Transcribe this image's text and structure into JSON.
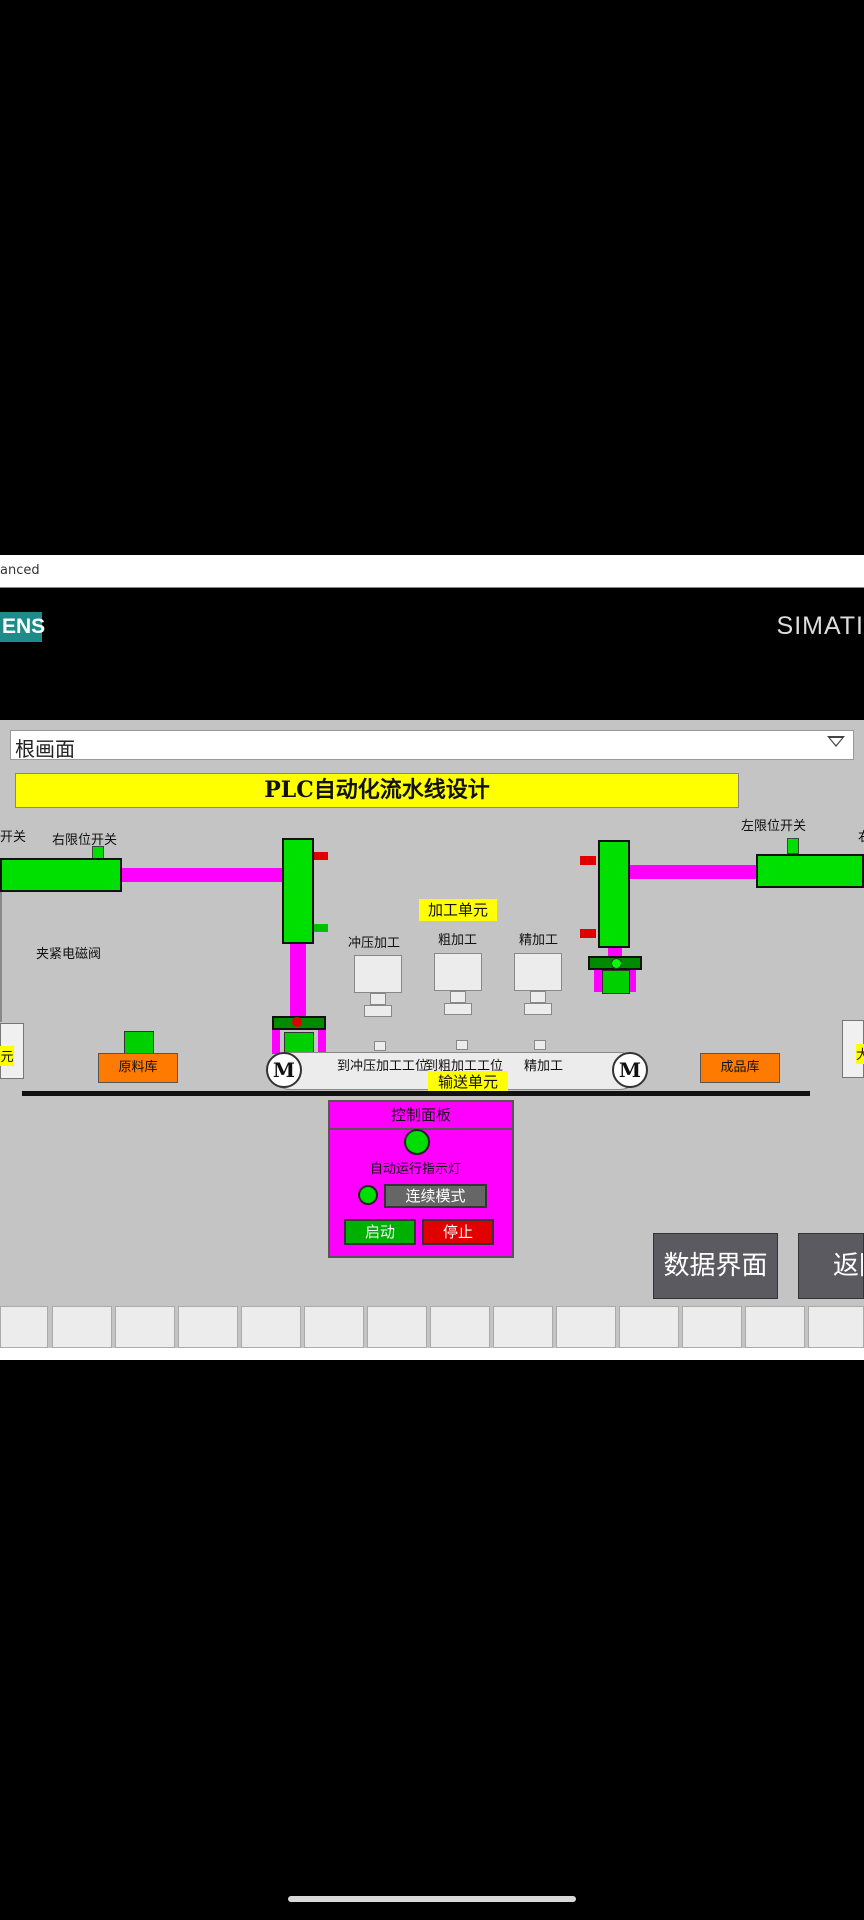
{
  "window": {
    "title": "anced"
  },
  "brand": {
    "logo_text": "ENS",
    "product": "SIMATI"
  },
  "screen_selector": {
    "value": "根画面"
  },
  "banner": {
    "title": "PLC自动化流水线设计"
  },
  "labels": {
    "left_cut_switch": "开关",
    "right_limit_switch": "右限位开关",
    "clamp_valve": "夹紧电磁阀",
    "left_unit_cut": "元",
    "left_limit_switch": "左限位开关",
    "right_cut": "右",
    "right_unit_cut": "大",
    "processing_unit": "加工单元",
    "tool_press": "冲压加工",
    "tool_rough": "粗加工",
    "tool_fine": "精加工",
    "pos_press": "到冲压加工工位",
    "pos_rough": "到粗加工工位",
    "pos_fine": "精加工",
    "raw_store": "原料库",
    "finished_store": "成品库",
    "conveyor_unit": "输送单元",
    "motor": "M"
  },
  "control_panel": {
    "title": "控制面板",
    "indicator_label": "自动运行指示灯",
    "mode_button": "连续模式",
    "start_button": "启动",
    "stop_button": "停止"
  },
  "nav": {
    "data_screen": "数据界面",
    "back": "返回"
  },
  "colors": {
    "actuator": "#00e000",
    "rod": "#ff00ff",
    "store": "#ff7a00",
    "banner": "#ffff00",
    "panel": "#ff00ff",
    "stop": "#e00000"
  }
}
